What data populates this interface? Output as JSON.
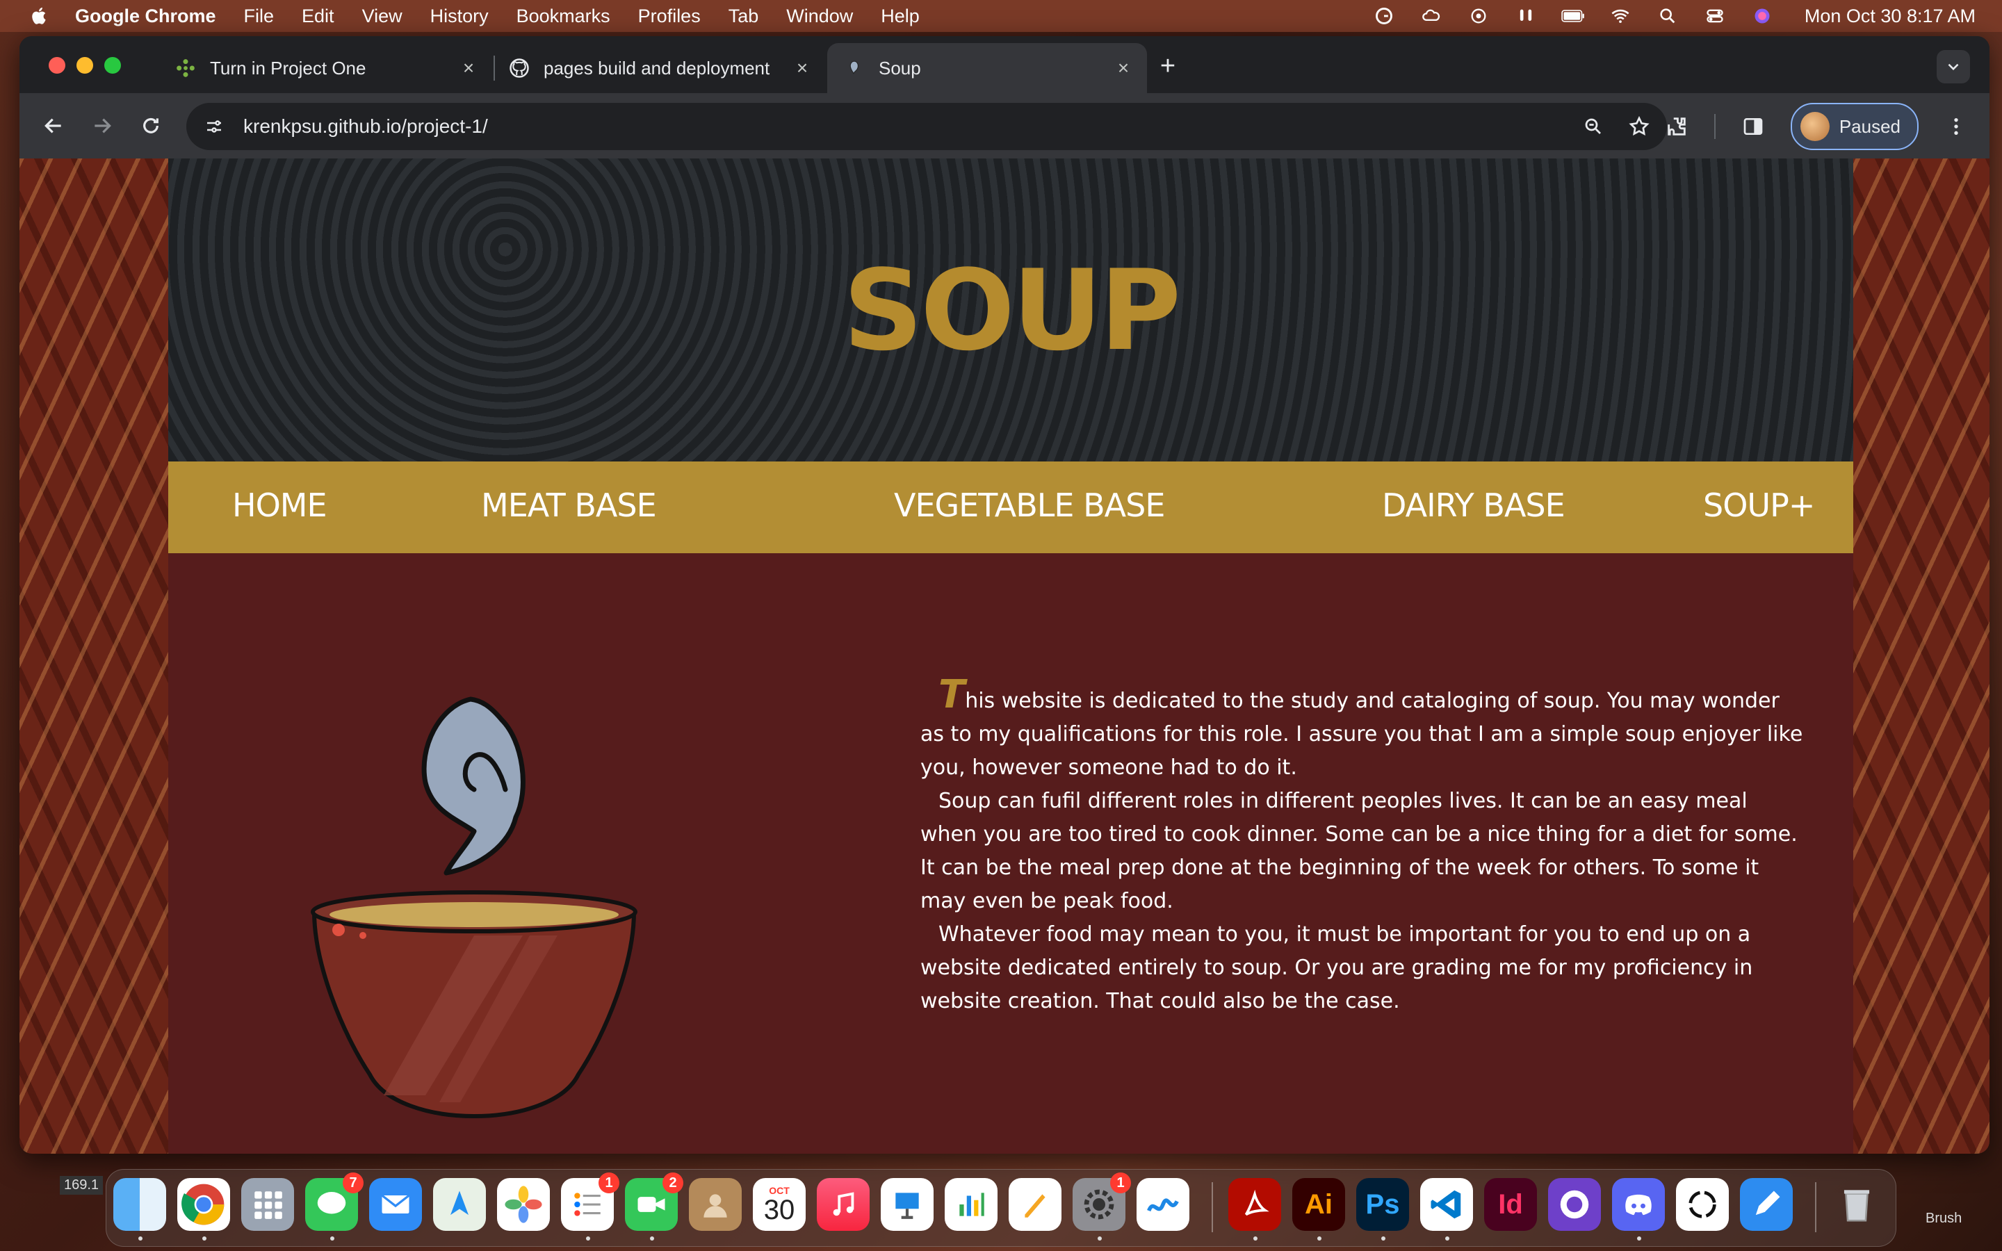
{
  "menubar": {
    "app_name": "Google Chrome",
    "items": [
      "File",
      "Edit",
      "View",
      "History",
      "Bookmarks",
      "Profiles",
      "Tab",
      "Window",
      "Help"
    ],
    "clock": "Mon Oct 30  8:17 AM"
  },
  "tabs": [
    {
      "title": "Turn in Project One",
      "active": false
    },
    {
      "title": "pages build and deployment",
      "active": false
    },
    {
      "title": "Soup",
      "active": true
    }
  ],
  "toolbar": {
    "url": "krenkpsu.github.io/project-1/",
    "profile_label": "Paused"
  },
  "page": {
    "title": "SOUP",
    "nav": [
      "HOME",
      "MEAT BASE",
      "VEGETABLE BASE",
      "DAIRY BASE",
      "SOUP+"
    ],
    "dropcap": "T",
    "para1": "his website is dedicated to the study and cataloging of soup. You may wonder as to my qualifications for this role. I assure you that I am a simple soup enjoyer like you, however someone had to do it.",
    "para2": "Soup can fufil different roles in different peoples lives. It can be an easy meal when you are too tired to cook dinner. Some can be a nice thing for a diet for some. It can be the meal prep done at the beginning of the week for others. To some it may even be peak food.",
    "para3": "Whatever food may mean to you, it must be important for you to end up on a website dedicated entirely to soup. Or you are grading me for my proficiency in website creation. That could also be the case."
  },
  "dock": {
    "messages_badge": "7",
    "reminders_badge": "1",
    "facetime_badge": "2",
    "calendar_month": "OCT",
    "calendar_day": "30",
    "settings_badge": "1",
    "illustrator_label": "Ai",
    "photoshop_label": "Ps",
    "indesign_label": "Id"
  },
  "misc": {
    "left_readout": "169.1",
    "right_label": "Brush"
  },
  "colors": {
    "nav_gold": "#b38e34",
    "title_gold": "#b58b2e",
    "page_maroon": "#561c1c"
  }
}
